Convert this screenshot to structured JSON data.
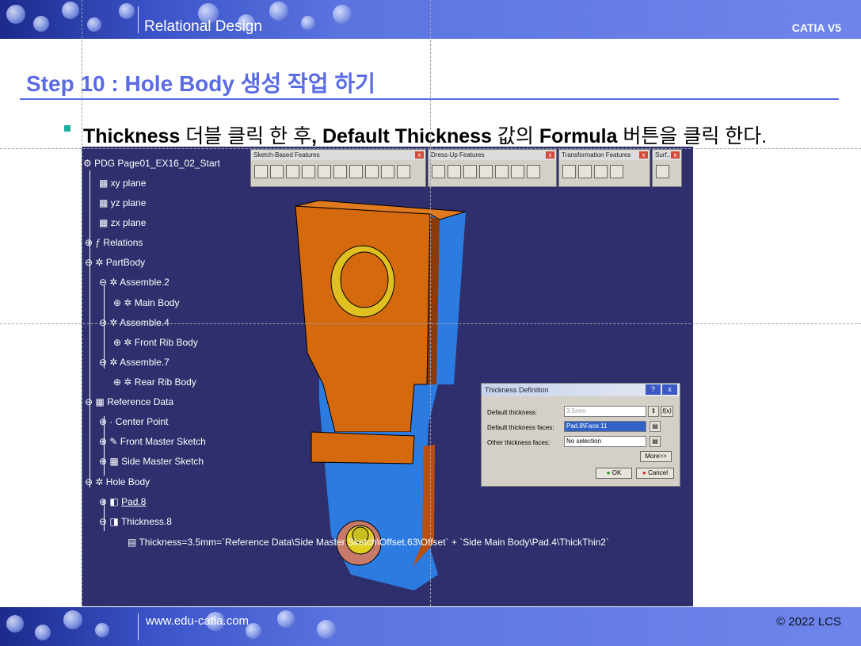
{
  "header": {
    "title": "Relational Design",
    "product": "CATIA V5"
  },
  "step_title": "Step 10 : Hole Body 생성 작업 하기",
  "instruction": {
    "part1": "Thickness",
    "part2": " 더블 클릭 한 후",
    "part3": ", Default Thickness",
    "part4": " 값의 ",
    "part5": "Formula",
    "part6": " 버튼을 클릭 한다."
  },
  "toolbars": [
    {
      "title": "Sketch-Based Features"
    },
    {
      "title": "Dress-Up Features"
    },
    {
      "title": "Transformation Features"
    },
    {
      "title": "Surf..."
    }
  ],
  "tree": {
    "root": "PDG Page01_EX16_02_Start",
    "xy": "xy plane",
    "yz": "yz plane",
    "zx": "zx plane",
    "relations": "Relations",
    "partbody": "PartBody",
    "assemble2": "Assemble.2",
    "main_body": "Main Body",
    "assemble4": "Assemble.4",
    "front_rib": "Front Rib Body",
    "assemble7": "Assemble.7",
    "rear_rib": "Rear Rib Body",
    "ref_data": "Reference Data",
    "center_point": "Center Point",
    "front_sketch": "Front Master Sketch",
    "side_sketch": "Side Master Sketch",
    "hole_body": "Hole Body",
    "pad8": "Pad.8",
    "thickness8": "Thickness.8",
    "formula": "Thickness=3.5mm=`Reference Data\\Side Master Sketch\\Offset.63\\Offset` + `Side Main Body\\Pad.4\\ThickThin2`"
  },
  "dialog": {
    "title": "Thickness Definition",
    "help": "?",
    "close": "x",
    "default_thickness_label": "Default thickness:",
    "default_thickness_value": "3.5mm",
    "faces_label": "Default thickness faces:",
    "faces_value": "Pad.8\\Face.11",
    "other_label": "Other thickness faces:",
    "other_value": "No selection",
    "more": "More>>",
    "ok": "OK",
    "cancel": "Cancel",
    "formula_btn": "f(x)"
  },
  "footer": {
    "url": "www.edu-catia.com",
    "copyright": "© 2022 LCS"
  },
  "colors": {
    "accent": "#5b6be6",
    "viewport_bg": "#2e2f6c",
    "part_orange": "#d4690e",
    "part_blue": "#2c7be0",
    "hole_yellow": "#e0c020"
  }
}
